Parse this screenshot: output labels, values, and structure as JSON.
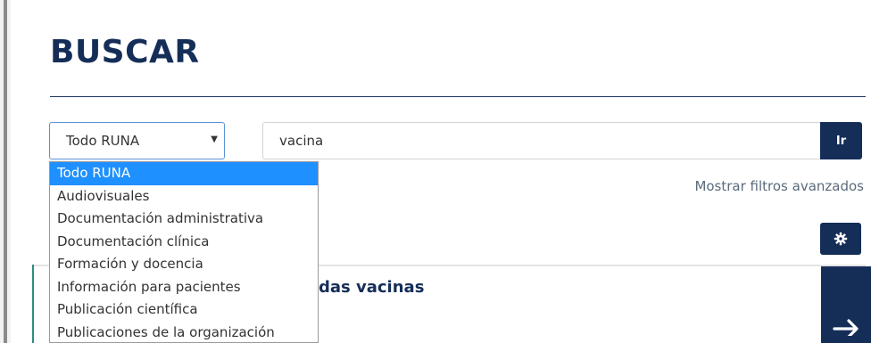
{
  "page": {
    "title": "BUSCAR"
  },
  "search": {
    "scope_selected": "Todo RUNA",
    "query": "vacina",
    "go_label": "Ir",
    "advanced_link": "Mostrar filtros avanzados"
  },
  "scope_options": [
    "Todo RUNA",
    "Audiovisuales",
    "Documentación administrativa",
    "Documentación clínica",
    "Formación y docencia",
    "Información para pacientes",
    "Publicación científica",
    "Publicaciones de la organización"
  ],
  "results": {
    "first_title_visible": "das vacinas"
  },
  "colors": {
    "navy": "#152e58",
    "dropdown_highlight": "#1e90ff",
    "accent_teal": "#2a8e7b"
  },
  "icons": {
    "gear": "gear-icon",
    "arrow": "arrow-right-icon",
    "caret": "caret-down-icon"
  }
}
